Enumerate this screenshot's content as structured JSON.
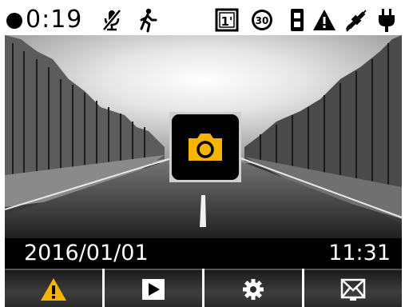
{
  "status_bar": {
    "record_time": "0:19",
    "icons": [
      "recording-dot-icon",
      "microphone-muted-icon",
      "motion-detection-icon",
      "loop-recording-1min-icon",
      "speed-30-icon",
      "traffic-light-icon",
      "warning-icon",
      "gps-satellite-icon",
      "power-plug-icon"
    ],
    "loop_label": "1'",
    "speed_label": "30"
  },
  "viewport": {
    "capture_button_icon": "camera-icon",
    "accent_color": "#f5b400"
  },
  "datebar": {
    "date": "2016/01/01",
    "time": "11:31"
  },
  "toolbar": {
    "buttons": [
      {
        "icon": "warning-icon",
        "color": "#f5b400"
      },
      {
        "icon": "play-icon",
        "color": "#ffffff"
      },
      {
        "icon": "gear-icon",
        "color": "#ffffff"
      },
      {
        "icon": "mail-icon",
        "color": "#ffffff"
      }
    ]
  }
}
